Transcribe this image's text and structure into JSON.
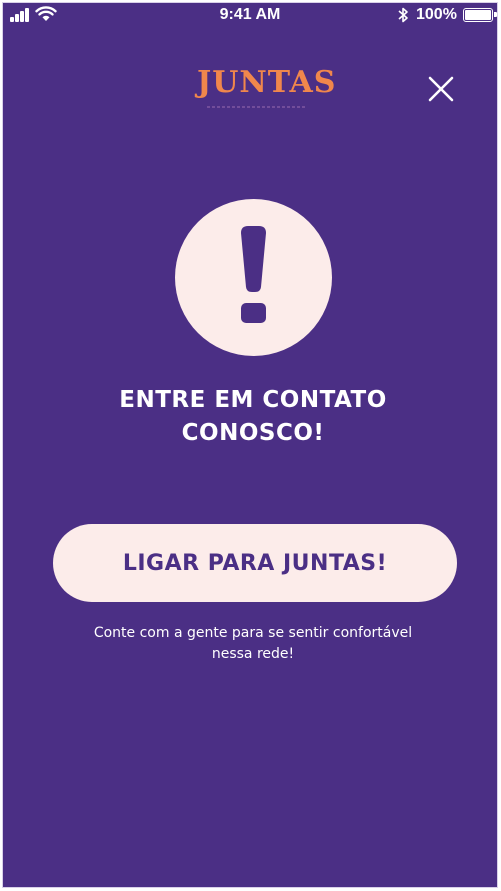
{
  "status_bar": {
    "time": "9:41 AM",
    "battery_percent": "100%"
  },
  "header": {
    "logo_text": "JUNTAS",
    "logo_color": "#f0874c",
    "close_icon": "close-icon"
  },
  "alert": {
    "icon": "exclamation-icon",
    "heading_line1": "ENTRE EM CONTATO",
    "heading_line2": "CONOSCO!"
  },
  "call_button": {
    "label": "LIGAR PARA JUNTAS!"
  },
  "subtext": {
    "line1": "Conte com a gente para se sentir confortável",
    "line2": "nessa rede!"
  },
  "colors": {
    "background": "#4b2f85",
    "accent_light": "#fcecea",
    "logo": "#f0874c"
  }
}
